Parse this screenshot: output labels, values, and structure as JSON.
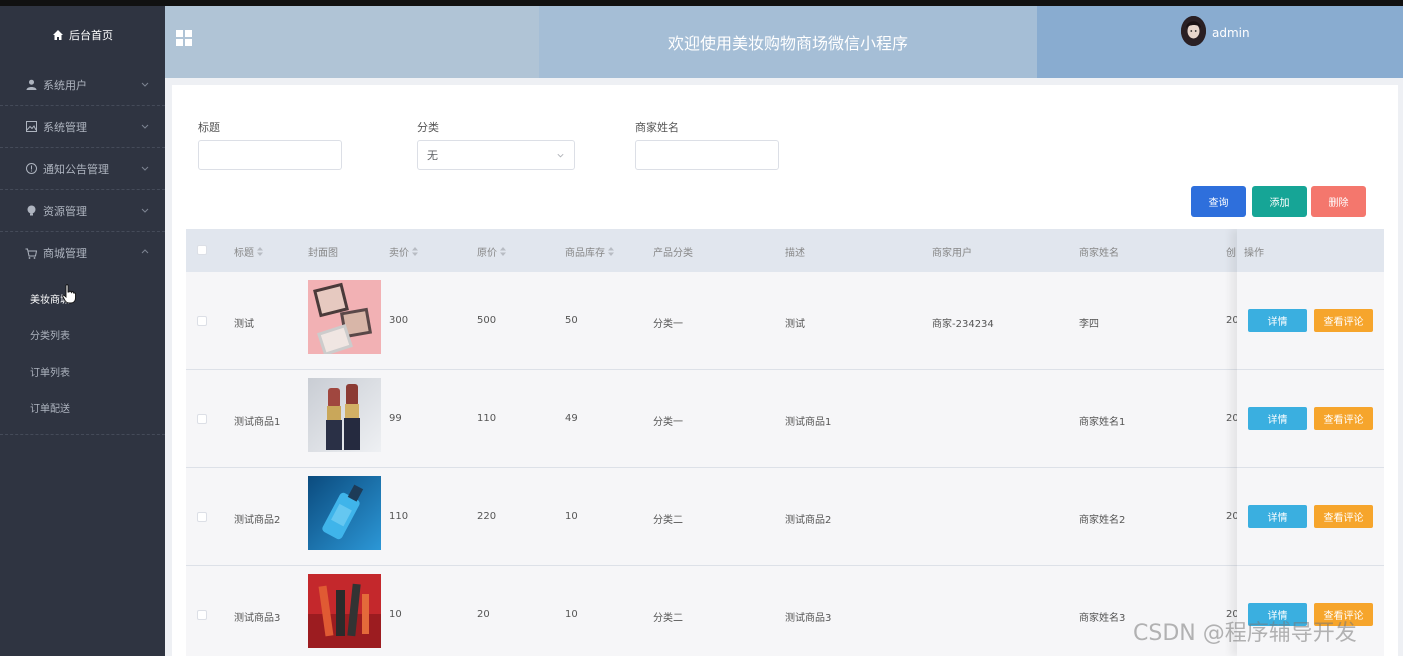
{
  "sidebar": {
    "home_label": "后台首页",
    "menus": [
      {
        "label": "系统用户",
        "icon": "user-icon"
      },
      {
        "label": "系统管理",
        "icon": "image-icon"
      },
      {
        "label": "通知公告管理",
        "icon": "info-icon"
      },
      {
        "label": "资源管理",
        "icon": "bulb-icon"
      },
      {
        "label": "商城管理",
        "icon": "cart-icon"
      }
    ],
    "submenu": [
      "美妆商城",
      "分类列表",
      "订单列表",
      "订单配送"
    ]
  },
  "header": {
    "title": "欢迎使用美妆购物商场微信小程序",
    "username": "admin"
  },
  "filters": {
    "title_label": "标题",
    "category_label": "分类",
    "category_value": "无",
    "merchant_label": "商家姓名"
  },
  "buttons": {
    "query": "查询",
    "add": "添加",
    "delete": "删除"
  },
  "table": {
    "headers": [
      "标题",
      "封面图",
      "卖价",
      "原价",
      "商品库存",
      "产品分类",
      "描述",
      "商家用户",
      "商家姓名",
      "创",
      "操作"
    ],
    "rows": [
      {
        "title": "测试",
        "price": "300",
        "original": "500",
        "stock": "50",
        "category": "分类一",
        "desc": "测试",
        "merchant_user": "商家-234234",
        "merchant_name": "李四",
        "created": "20"
      },
      {
        "title": "测试商品1",
        "price": "99",
        "original": "110",
        "stock": "49",
        "category": "分类一",
        "desc": "测试商品1",
        "merchant_user": "",
        "merchant_name": "商家姓名1",
        "created": "20"
      },
      {
        "title": "测试商品2",
        "price": "110",
        "original": "220",
        "stock": "10",
        "category": "分类二",
        "desc": "测试商品2",
        "merchant_user": "",
        "merchant_name": "商家姓名2",
        "created": "20"
      },
      {
        "title": "测试商品3",
        "price": "10",
        "original": "20",
        "stock": "10",
        "category": "分类二",
        "desc": "测试商品3",
        "merchant_user": "",
        "merchant_name": "商家姓名3",
        "created": "20"
      }
    ],
    "detail_label": "详情",
    "comments_label": "查看评论"
  },
  "watermark": "CSDN @程序辅导开发",
  "colors": {
    "sidebar_bg": "#2f3441",
    "query_btn": "#2e6fdc",
    "add_btn": "#16a596",
    "delete_btn": "#f4776d",
    "detail_btn": "#3aafe0",
    "comments_btn": "#f6a52c"
  }
}
